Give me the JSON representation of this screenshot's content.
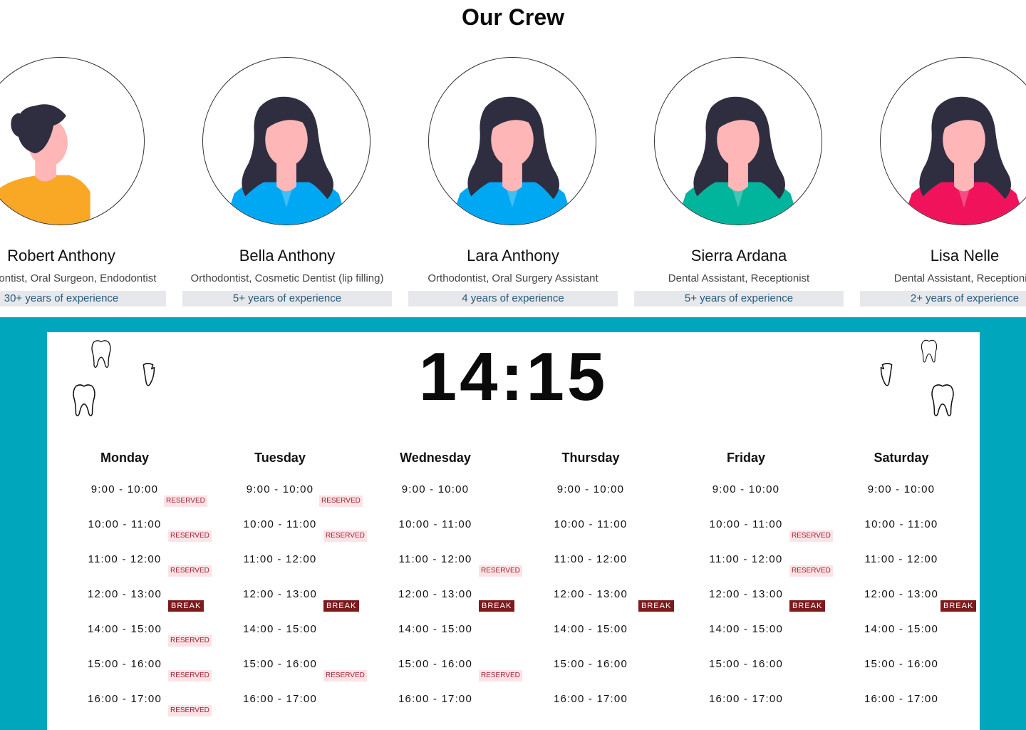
{
  "crew": {
    "title": "Our Crew",
    "members": [
      {
        "name": "Robert Anthony",
        "role": "Orthodontist, Oral Surgeon, Endodontist",
        "experience": "30+ years of experience",
        "shirt": "#f9a826",
        "avatar": "man-avatar-icon"
      },
      {
        "name": "Bella Anthony",
        "role": "Orthodontist, Cosmetic Dentist (lip filling)",
        "experience": "5+ years of experience",
        "shirt": "#00a8f3",
        "avatar": "woman-avatar-icon"
      },
      {
        "name": "Lara Anthony",
        "role": "Orthodontist, Oral Surgery Assistant",
        "experience": "4 years of experience",
        "shirt": "#00a8f3",
        "avatar": "woman-avatar-icon"
      },
      {
        "name": "Sierra Ardana",
        "role": "Dental Assistant, Receptionist",
        "experience": "5+ years of experience",
        "shirt": "#00b59c",
        "avatar": "woman-avatar-icon"
      },
      {
        "name": "Lisa Nelle",
        "role": "Dental Assistant, Receptionist",
        "experience": "2+ years of experience",
        "shirt": "#f0125a",
        "avatar": "woman-avatar-icon"
      }
    ]
  },
  "schedule": {
    "clock": "14:15",
    "tag_labels": {
      "reserved": "RESERVED",
      "break": "BREAK"
    },
    "days": [
      {
        "name": "Monday",
        "slots": [
          {
            "time": "9:00 - 10:00",
            "tag": "reserved"
          },
          {
            "time": "10:00 - 11:00",
            "tag": "reserved"
          },
          {
            "time": "11:00 - 12:00",
            "tag": "reserved"
          },
          {
            "time": "12:00 - 13:00",
            "tag": "break"
          },
          {
            "time": "14:00 - 15:00",
            "tag": "reserved"
          },
          {
            "time": "15:00 - 16:00",
            "tag": "reserved"
          },
          {
            "time": "16:00 - 17:00",
            "tag": "reserved"
          }
        ]
      },
      {
        "name": "Tuesday",
        "slots": [
          {
            "time": "9:00 - 10:00",
            "tag": "reserved"
          },
          {
            "time": "10:00 - 11:00",
            "tag": "reserved"
          },
          {
            "time": "11:00 - 12:00",
            "tag": ""
          },
          {
            "time": "12:00 - 13:00",
            "tag": "break"
          },
          {
            "time": "14:00 - 15:00",
            "tag": ""
          },
          {
            "time": "15:00 - 16:00",
            "tag": "reserved"
          },
          {
            "time": "16:00 - 17:00",
            "tag": ""
          }
        ]
      },
      {
        "name": "Wednesday",
        "slots": [
          {
            "time": "9:00 - 10:00",
            "tag": ""
          },
          {
            "time": "10:00 - 11:00",
            "tag": ""
          },
          {
            "time": "11:00 - 12:00",
            "tag": "reserved"
          },
          {
            "time": "12:00 - 13:00",
            "tag": "break"
          },
          {
            "time": "14:00 - 15:00",
            "tag": ""
          },
          {
            "time": "15:00 - 16:00",
            "tag": "reserved"
          },
          {
            "time": "16:00 - 17:00",
            "tag": ""
          }
        ]
      },
      {
        "name": "Thursday",
        "slots": [
          {
            "time": "9:00 - 10:00",
            "tag": ""
          },
          {
            "time": "10:00 - 11:00",
            "tag": ""
          },
          {
            "time": "11:00 - 12:00",
            "tag": ""
          },
          {
            "time": "12:00 - 13:00",
            "tag": "break"
          },
          {
            "time": "14:00 - 15:00",
            "tag": ""
          },
          {
            "time": "15:00 - 16:00",
            "tag": ""
          },
          {
            "time": "16:00 - 17:00",
            "tag": ""
          }
        ]
      },
      {
        "name": "Friday",
        "slots": [
          {
            "time": "9:00 - 10:00",
            "tag": ""
          },
          {
            "time": "10:00 - 11:00",
            "tag": "reserved"
          },
          {
            "time": "11:00 - 12:00",
            "tag": "reserved"
          },
          {
            "time": "12:00 - 13:00",
            "tag": "break"
          },
          {
            "time": "14:00 - 15:00",
            "tag": ""
          },
          {
            "time": "15:00 - 16:00",
            "tag": ""
          },
          {
            "time": "16:00 - 17:00",
            "tag": ""
          }
        ]
      },
      {
        "name": "Saturday",
        "slots": [
          {
            "time": "9:00 - 10:00",
            "tag": ""
          },
          {
            "time": "10:00 - 11:00",
            "tag": ""
          },
          {
            "time": "11:00 - 12:00",
            "tag": ""
          },
          {
            "time": "12:00 - 13:00",
            "tag": "break"
          },
          {
            "time": "14:00 - 15:00",
            "tag": ""
          },
          {
            "time": "15:00 - 16:00",
            "tag": ""
          },
          {
            "time": "16:00 - 17:00",
            "tag": ""
          }
        ]
      }
    ]
  },
  "colors": {
    "teal": "#00a6bc",
    "reserved_bg": "#fde3e6",
    "reserved_text": "#9b2030",
    "break_bg": "#7d1a1c",
    "hair": "#2f2e41",
    "skin": "#ffb6b6"
  },
  "decorations": {
    "tooth_icon": "tooth-icon"
  }
}
